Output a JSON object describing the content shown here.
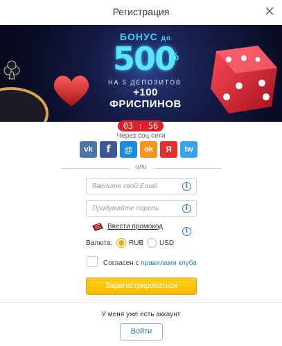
{
  "header": {
    "title": "Регистрация",
    "close_icon": "close-icon"
  },
  "banner": {
    "line1": "БОНУС",
    "line1_small": "до",
    "amount": "500",
    "percent": "%",
    "line3": "НА 5 ДЕПОЗИТОВ",
    "line4": "+100 ФРИСПИНОВ"
  },
  "timer": "03 : 56",
  "social": {
    "label": "Через соц сети",
    "buttons": [
      {
        "icon": "vk-icon",
        "glyph": "vk",
        "color": "#4a76a8"
      },
      {
        "icon": "facebook-icon",
        "glyph": "f",
        "color": "#3b5998"
      },
      {
        "icon": "mailru-icon",
        "glyph": "@",
        "color": "#168de2"
      },
      {
        "icon": "odnoklassniki-icon",
        "glyph": "ok",
        "color": "#f7931e"
      },
      {
        "icon": "yandex-icon",
        "glyph": "Я",
        "color": "#e62e2e"
      },
      {
        "icon": "twitter-icon",
        "glyph": "tw",
        "color": "#3ea1ec"
      }
    ]
  },
  "or_label": "или",
  "form": {
    "email_placeholder": "Введите свой Email",
    "email_value": "",
    "password_placeholder": "Придумайте пароль",
    "password_value": "",
    "promo_link": "Ввести промокод",
    "currency_label": "Валюта:",
    "currency_options": [
      "RUB",
      "USD"
    ],
    "currency_selected": "RUB",
    "agree_prefix": "Согласен с ",
    "agree_link": "правилами клуба",
    "register_label": "Зарегистрироваться"
  },
  "footer": {
    "have_account": "У меня уже есть аккаунт",
    "login_label": "Войти"
  },
  "colors": {
    "accent": "#f5a800",
    "link": "#2a7fd1",
    "timer": "#e01e28"
  }
}
